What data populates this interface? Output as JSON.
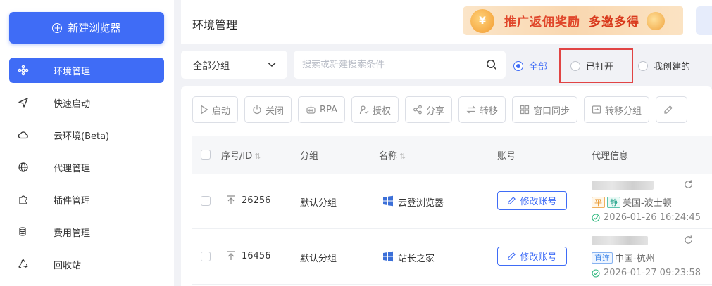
{
  "sidebar": {
    "new_button": "新建浏览器",
    "items": [
      {
        "label": "环境管理",
        "icon": "environment-icon",
        "active": true
      },
      {
        "label": "快速启动",
        "icon": "send-icon"
      },
      {
        "label": "云环境(Beta)",
        "icon": "cloud-icon"
      },
      {
        "label": "代理管理",
        "icon": "globe-icon"
      },
      {
        "label": "插件管理",
        "icon": "plugin-icon"
      },
      {
        "label": "费用管理",
        "icon": "coins-icon"
      },
      {
        "label": "回收站",
        "icon": "recycle-icon"
      }
    ]
  },
  "header": {
    "title": "环境管理",
    "promo": {
      "text1": "推广返佣奖励",
      "text2": "多邀多得"
    }
  },
  "filters": {
    "group_select": "全部分组",
    "search_placeholder": "搜索或新建搜索条件",
    "radios": [
      {
        "label": "全部",
        "checked": true
      },
      {
        "label": "已打开",
        "checked": false
      },
      {
        "label": "我创建的",
        "checked": false
      }
    ]
  },
  "toolbar": {
    "start": "启动",
    "close": "关闭",
    "rpa": "RPA",
    "authorize": "授权",
    "share": "分享",
    "transfer": "转移",
    "window_sync": "窗口同步",
    "transfer_group": "转移分组"
  },
  "table": {
    "headers": {
      "id": "序号/ID",
      "group": "分组",
      "name": "名称",
      "account": "账号",
      "proxy": "代理信息"
    },
    "rows": [
      {
        "id": "26256",
        "group": "默认分组",
        "name": "云登浏览器",
        "account_button": "修改账号",
        "tags": [
          "平",
          "静"
        ],
        "location": "美国-波士顿",
        "time": "2026-01-26 16:24:45"
      },
      {
        "id": "16456",
        "group": "默认分组",
        "name": "站长之家",
        "account_button": "修改账号",
        "tags": [
          "直连"
        ],
        "location": "中国-杭州",
        "time": "2026-01-27 09:23:58"
      }
    ]
  },
  "colors": {
    "accent": "#3f6cf6",
    "highlight": "#e14444"
  }
}
